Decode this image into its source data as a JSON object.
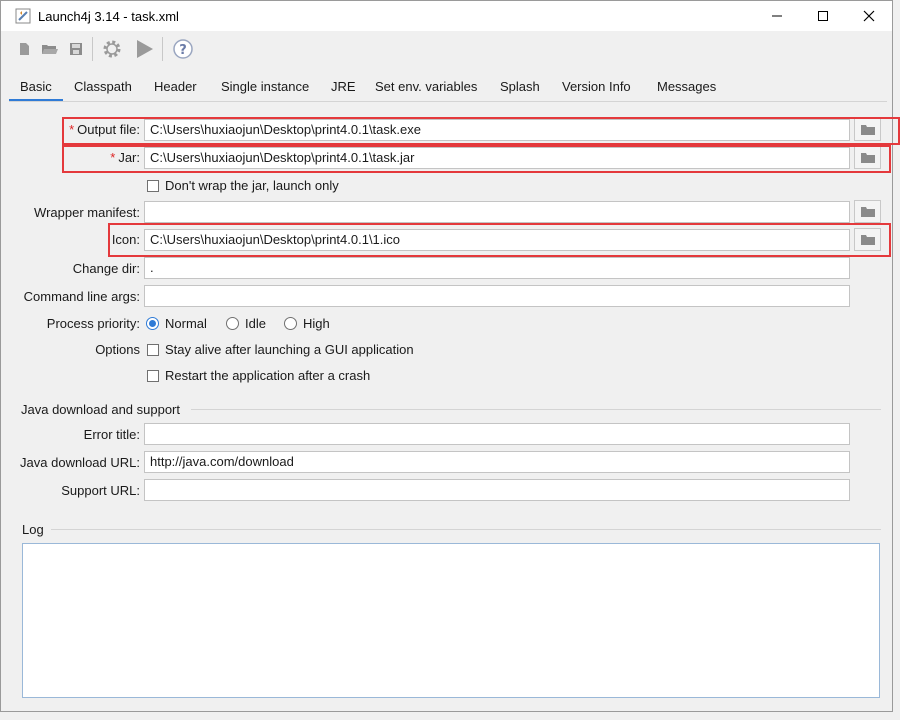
{
  "window": {
    "title": "Launch4j 3.14 - task.xml"
  },
  "tabs": [
    "Basic",
    "Classpath",
    "Header",
    "Single instance",
    "JRE",
    "Set env. variables",
    "Splash",
    "Version Info",
    "Messages"
  ],
  "form": {
    "output_file": {
      "label": "Output file:",
      "required_mark": "*",
      "value": "C:\\Users\\huxiaojun\\Desktop\\print4.0.1\\task.exe"
    },
    "jar": {
      "label": "Jar:",
      "required_mark": "*",
      "value": "C:\\Users\\huxiaojun\\Desktop\\print4.0.1\\task.jar"
    },
    "dont_wrap": {
      "label": "Don't wrap the jar, launch only",
      "checked": false
    },
    "wrapper_manifest": {
      "label": "Wrapper manifest:",
      "value": ""
    },
    "icon": {
      "label": "Icon:",
      "value": "C:\\Users\\huxiaojun\\Desktop\\print4.0.1\\1.ico"
    },
    "change_dir": {
      "label": "Change dir:",
      "value": "."
    },
    "cmd_args": {
      "label": "Command line args:",
      "value": ""
    },
    "priority": {
      "label": "Process priority:",
      "options": [
        "Normal",
        "Idle",
        "High"
      ],
      "selected": "Normal"
    },
    "options": {
      "label": "Options",
      "stay_alive": {
        "label": "Stay alive after launching a GUI application",
        "checked": false
      },
      "restart": {
        "label": "Restart the application after a crash",
        "checked": false
      }
    }
  },
  "java_download": {
    "section_title": "Java download and support",
    "error_title": {
      "label": "Error title:",
      "value": ""
    },
    "download_url": {
      "label": "Java download URL:",
      "value": "http://java.com/download"
    },
    "support_url": {
      "label": "Support URL:",
      "value": ""
    }
  },
  "log": {
    "section_title": "Log",
    "content": ""
  },
  "colors": {
    "highlight": "#e4393c",
    "accent": "#2f7bd6"
  }
}
